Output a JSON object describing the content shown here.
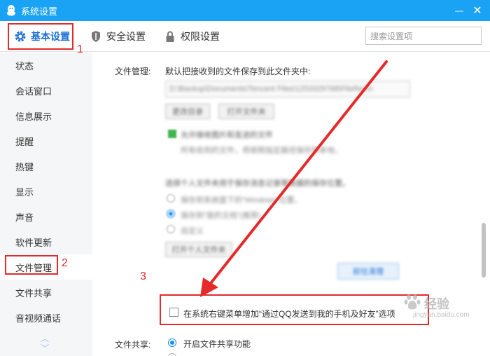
{
  "window": {
    "title": "系统设置",
    "minimize_glyph": "—",
    "close_glyph": "✕"
  },
  "tabs": {
    "basic": "基本设置",
    "security": "安全设置",
    "permission": "权限设置"
  },
  "search": {
    "placeholder": "搜索设置项"
  },
  "sidebar": {
    "items": [
      {
        "label": "状态"
      },
      {
        "label": "会话窗口"
      },
      {
        "label": "信息展示"
      },
      {
        "label": "提醒"
      },
      {
        "label": "热键"
      },
      {
        "label": "显示"
      },
      {
        "label": "声音"
      },
      {
        "label": "软件更新"
      },
      {
        "label": "文件管理"
      },
      {
        "label": "文件共享"
      },
      {
        "label": "音视频通话"
      }
    ],
    "active": "文件管理"
  },
  "content": {
    "file_mgmt_label": "文件管理:",
    "file_mgmt_desc": "默认把接收到的文件保存到此文件夹中:",
    "checkbox_label": "在系统右键菜单增加“通过QQ发送到我的手机及好友”选项",
    "file_share_label": "文件共享:",
    "file_share_option": "开启文件共享功能",
    "blurred_path": "D:\\Backup\\Documents\\Tencent Files\\1253329768\\FileRecv\\",
    "blurred_btn1": "更改目录",
    "blurred_btn2": "打开文件夹",
    "blurred_check": "允许接收图片和发送的文件",
    "blurred_desc1": "所有收到的文件，将按照指定路径保存到本地，",
    "blurred_desc2": "",
    "blurred_q": "选择个人文件夹用于保存消息记录等数据的保存位置。",
    "blurred_r1": "保存到系统盘下的\"Windows\"位置，",
    "blurred_r2": "保存到\"我的文档\"(推荐)",
    "blurred_r3": "自定义",
    "blurred_btn3": "打开个人文件夹",
    "blurred_line": "",
    "blurred_btn4": "前往清理",
    "blurred_auto": ""
  },
  "annotations": {
    "n1": "1",
    "n2": "2",
    "n3": "3"
  },
  "watermark": {
    "text": "经验",
    "sub": "jingyan.baidu.com"
  },
  "colors": {
    "titlebar": "#1aa3f5",
    "accent": "#1a6fd6",
    "annotation": "#e52a2a"
  }
}
